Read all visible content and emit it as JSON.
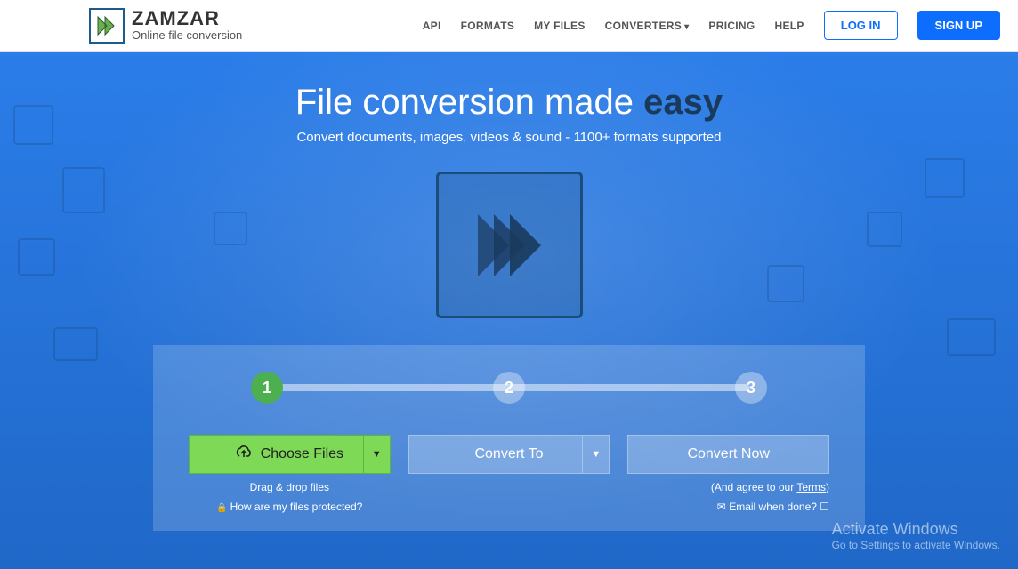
{
  "brand": {
    "name": "ZAMZAR",
    "tagline": "Online file conversion"
  },
  "nav": {
    "items": [
      "API",
      "FORMATS",
      "MY FILES",
      "CONVERTERS",
      "PRICING",
      "HELP"
    ],
    "login": "LOG IN",
    "signup": "SIGN UP"
  },
  "hero": {
    "title_pre": "File conversion made ",
    "title_em": "easy",
    "subtitle": "Convert documents, images, videos & sound - 1100+ formats supported"
  },
  "steps": {
    "num1": "1",
    "num2": "2",
    "num3": "3",
    "choose": "Choose Files",
    "convert_to": "Convert To",
    "convert_now": "Convert Now",
    "drag_hint": "Drag & drop files",
    "protect_hint": "How are my files protected?",
    "agree_pre": "(And agree to our ",
    "agree_link": "Terms",
    "agree_post": ")",
    "email_hint": "Email when done?"
  },
  "watermark": {
    "title": "Activate Windows",
    "sub": "Go to Settings to activate Windows."
  }
}
